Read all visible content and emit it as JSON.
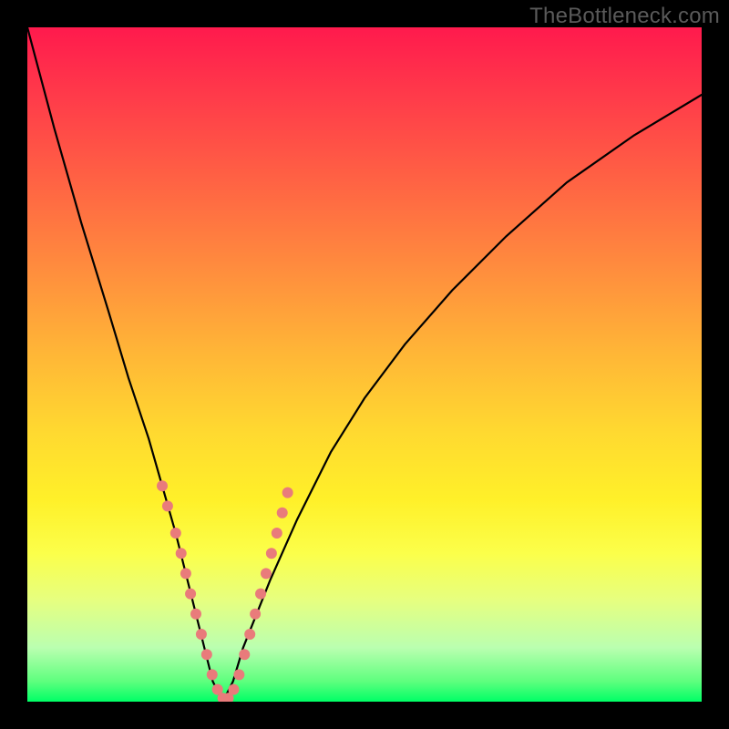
{
  "watermark": "TheBottleneck.com",
  "chart_data": {
    "type": "line",
    "title": "",
    "xlabel": "",
    "ylabel": "",
    "xlim": [
      0,
      100
    ],
    "ylim": [
      0,
      100
    ],
    "grid": false,
    "legend": false,
    "background_gradient": {
      "direction": "vertical",
      "stops": [
        {
          "t": 0.0,
          "color": "#ff1a4d"
        },
        {
          "t": 0.5,
          "color": "#ffd930"
        },
        {
          "t": 0.8,
          "color": "#fbff4a"
        },
        {
          "t": 1.0,
          "color": "#00ff66"
        }
      ]
    },
    "series": [
      {
        "name": "bottleneck-curve",
        "color": "#000000",
        "x": [
          0,
          4,
          8,
          12,
          15,
          18,
          20,
          22,
          24,
          26,
          27.5,
          29,
          30.5,
          32,
          36,
          40,
          45,
          50,
          56,
          63,
          71,
          80,
          90,
          100
        ],
        "y": [
          100,
          85,
          71,
          58,
          48,
          39,
          32,
          25,
          17,
          9,
          3,
          0,
          3,
          8,
          18,
          27,
          37,
          45,
          53,
          61,
          69,
          77,
          84,
          90
        ]
      }
    ],
    "scatter_points": {
      "name": "sample-points",
      "color": "#e97b7b",
      "radius": 6,
      "points": [
        {
          "x": 20.0,
          "y": 32
        },
        {
          "x": 20.8,
          "y": 29
        },
        {
          "x": 22.0,
          "y": 25
        },
        {
          "x": 22.8,
          "y": 22
        },
        {
          "x": 23.5,
          "y": 19
        },
        {
          "x": 24.2,
          "y": 16
        },
        {
          "x": 25.0,
          "y": 13
        },
        {
          "x": 25.8,
          "y": 10
        },
        {
          "x": 26.6,
          "y": 7
        },
        {
          "x": 27.4,
          "y": 4
        },
        {
          "x": 28.2,
          "y": 1.8
        },
        {
          "x": 29.0,
          "y": 0.5
        },
        {
          "x": 29.8,
          "y": 0.5
        },
        {
          "x": 30.6,
          "y": 1.8
        },
        {
          "x": 31.4,
          "y": 4
        },
        {
          "x": 32.2,
          "y": 7
        },
        {
          "x": 33.0,
          "y": 10
        },
        {
          "x": 33.8,
          "y": 13
        },
        {
          "x": 34.6,
          "y": 16
        },
        {
          "x": 35.4,
          "y": 19
        },
        {
          "x": 36.2,
          "y": 22
        },
        {
          "x": 37.0,
          "y": 25
        },
        {
          "x": 37.8,
          "y": 28
        },
        {
          "x": 38.6,
          "y": 31
        }
      ]
    }
  }
}
